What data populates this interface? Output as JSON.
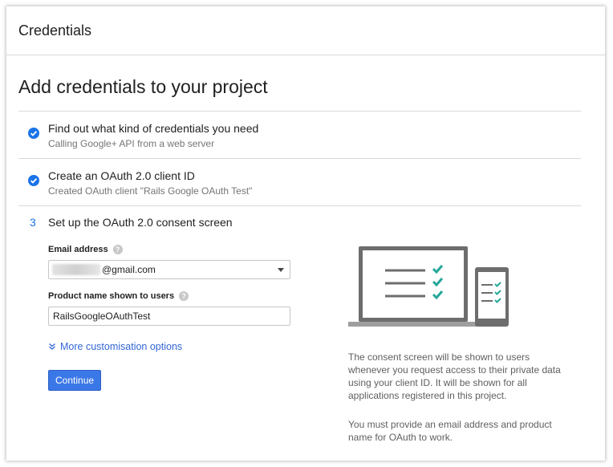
{
  "header": {
    "title": "Credentials"
  },
  "page_title": "Add credentials to your project",
  "steps": [
    {
      "title": "Find out what kind of credentials you need",
      "subtitle": "Calling Google+ API from a web server"
    },
    {
      "title": "Create an OAuth 2.0 client ID",
      "subtitle": "Created OAuth client \"Rails Google OAuth Test\""
    }
  ],
  "step3": {
    "number": "3",
    "title": "Set up the OAuth 2.0 consent screen",
    "email": {
      "label": "Email address",
      "value": "@gmail.com"
    },
    "product": {
      "label": "Product name shown to users",
      "value": "RailsGoogleOAuthTest"
    },
    "more_link": "More customisation options",
    "continue_label": "Continue",
    "help_glyph": "?"
  },
  "side_text": {
    "p1": "The consent screen will be shown to users whenever you request access to their private data using your client ID. It will be shown for all applications registered in this project.",
    "p2": "You must provide an email address and product name for OAuth to work."
  },
  "colors": {
    "accent": "#3b78e7",
    "check": "#1a73e8",
    "teal": "#26a69a",
    "device": "#616161"
  },
  "icons": [
    "checkmark-circle-icon",
    "help-icon",
    "dropdown-caret-icon",
    "expand-chevron-icon",
    "laptop-phone-illustration"
  ]
}
